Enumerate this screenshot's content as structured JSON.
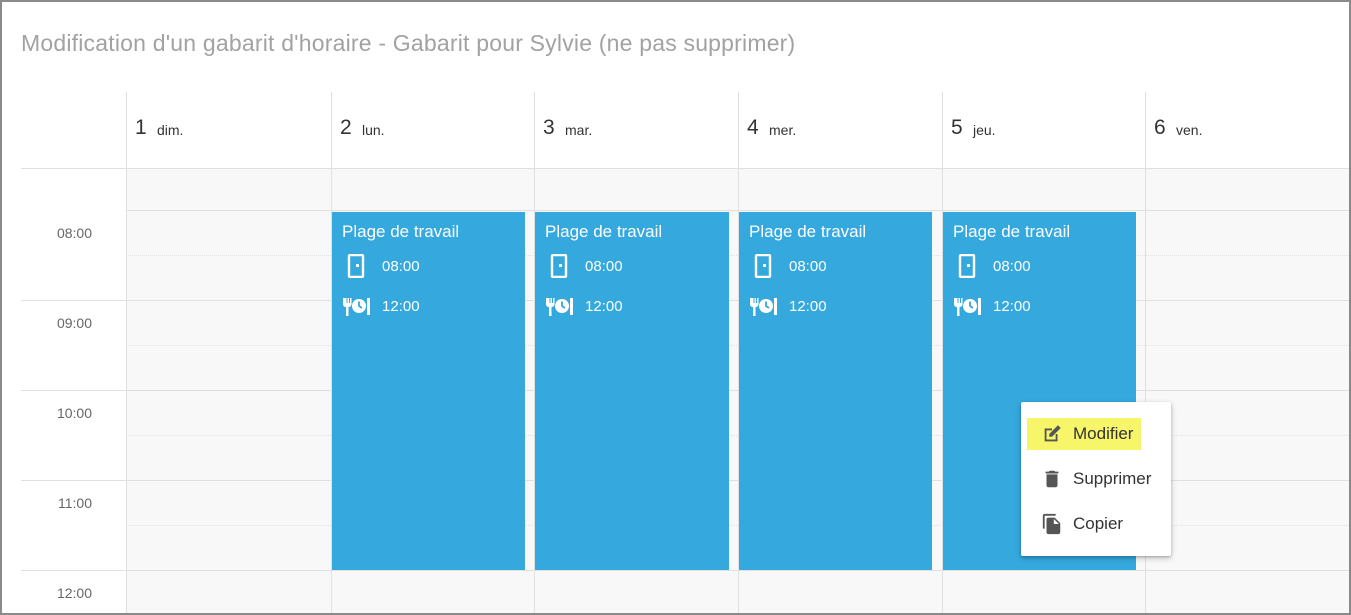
{
  "page": {
    "title": "Modification d'un gabarit d'horaire - Gabarit pour Sylvie (ne pas supprimer)"
  },
  "days": [
    {
      "num": "1",
      "name": "dim."
    },
    {
      "num": "2",
      "name": "lun."
    },
    {
      "num": "3",
      "name": "mar."
    },
    {
      "num": "4",
      "name": "mer."
    },
    {
      "num": "5",
      "name": "jeu."
    },
    {
      "num": "6",
      "name": "ven."
    }
  ],
  "times": [
    "08:00",
    "09:00",
    "10:00",
    "11:00",
    "12:00"
  ],
  "events": [
    {
      "title": "Plage de travail",
      "start": "08:00",
      "end": "12:00",
      "start_icon": "door-icon",
      "end_icon": "meal-clock-icon"
    },
    {
      "title": "Plage de travail",
      "start": "08:00",
      "end": "12:00",
      "start_icon": "door-icon",
      "end_icon": "meal-clock-icon"
    },
    {
      "title": "Plage de travail",
      "start": "08:00",
      "end": "12:00",
      "start_icon": "door-icon",
      "end_icon": "meal-clock-icon"
    },
    {
      "title": "Plage de travail",
      "start": "08:00",
      "end": "12:00",
      "start_icon": "door-icon",
      "end_icon": "meal-clock-icon"
    }
  ],
  "context_menu": {
    "items": [
      {
        "label": "Modifier",
        "icon": "edit-icon",
        "highlighted": true
      },
      {
        "label": "Supprimer",
        "icon": "trash-icon",
        "highlighted": false
      },
      {
        "label": "Copier",
        "icon": "copy-icon",
        "highlighted": false
      }
    ]
  },
  "colors": {
    "event": "#35a8de",
    "highlight": "#f7f56a",
    "title": "#a2a2a2"
  }
}
